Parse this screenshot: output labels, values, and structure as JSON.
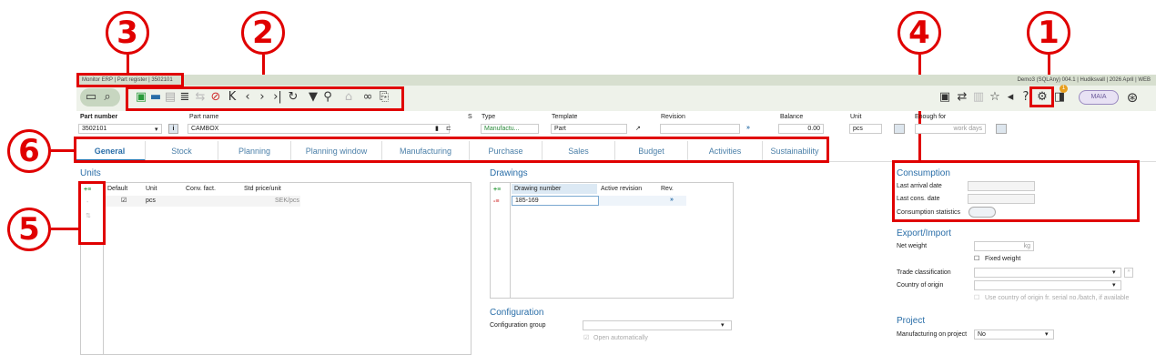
{
  "titlebar": {
    "left": "Monitor ERP | Part register | 3502101",
    "right": "Demo3 (SQLAny) 004.1 | Hudiksvall | 2026 April | WEB"
  },
  "callouts": [
    "1",
    "2",
    "3",
    "4",
    "5",
    "6"
  ],
  "header": {
    "part_number_label": "Part number",
    "part_number": "3502101",
    "part_name_label": "Part name",
    "part_name": "CAMBOX",
    "s_label": "S",
    "type_label": "Type",
    "type_value": "Manufactu...",
    "template_label": "Template",
    "template_value": "Part",
    "revision_label": "Revision",
    "balance_label": "Balance",
    "balance_value": "0.00",
    "unit_label": "Unit",
    "unit_value": "pcs",
    "enough_for_label": "Enough for",
    "enough_for_value": "work days"
  },
  "tabs": [
    "General",
    "Stock",
    "Planning",
    "Planning window",
    "Manufacturing",
    "Purchase",
    "Sales",
    "Budget",
    "Activities",
    "Sustainability"
  ],
  "units": {
    "title": "Units",
    "columns": [
      "Default",
      "Unit",
      "Conv. fact.",
      "Std price/unit"
    ],
    "rows": [
      {
        "unit": "pcs",
        "price": "SEK/pcs"
      }
    ]
  },
  "drawings": {
    "title": "Drawings",
    "columns": [
      "Drawing number",
      "Active revision",
      "Rev."
    ],
    "rows": [
      {
        "number": "185-169"
      }
    ]
  },
  "configuration": {
    "title": "Configuration",
    "group_label": "Configuration group",
    "open_auto": "Open automatically"
  },
  "consumption": {
    "title": "Consumption",
    "last_arrival": "Last arrival date",
    "last_cons": "Last cons. date",
    "stats": "Consumption statistics"
  },
  "export": {
    "title": "Export/Import",
    "net_weight": "Net weight",
    "kg": "kg",
    "fixed_weight": "Fixed weight",
    "trade": "Trade classification",
    "country": "Country of origin",
    "use_country": "Use country of origin fr. serial no./batch, if available"
  },
  "project": {
    "title": "Project",
    "manufacturing_label": "Manufacturing on project",
    "manufacturing_value": "No"
  },
  "maia": "MAIA",
  "badge": "1"
}
